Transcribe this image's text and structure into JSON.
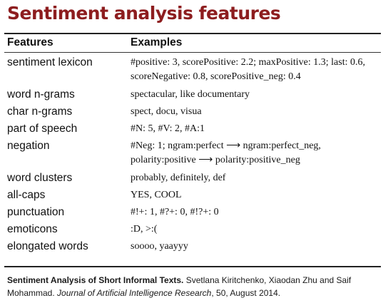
{
  "title": "Sentiment analysis features",
  "table": {
    "headers": {
      "features": "Features",
      "examples": "Examples"
    },
    "rows": [
      {
        "feature": "sentiment lexicon",
        "example": "#positive: 3, scorePositive: 2.2; maxPositive: 1.3; last: 0.6, scoreNegative: 0.8, scorePositive_neg: 0.4"
      },
      {
        "feature": "word n-grams",
        "example": "spectacular, like documentary"
      },
      {
        "feature": "char n-grams",
        "example": "spect, docu, visua"
      },
      {
        "feature": "part of speech",
        "example": "#N: 5, #V: 2, #A:1"
      },
      {
        "feature": "negation",
        "example": "#Neg: 1; ngram:perfect ⟶ ngram:perfect_neg, polarity:positive ⟶ polarity:positive_neg"
      },
      {
        "feature": "word clusters",
        "example": "probably, definitely, def"
      },
      {
        "feature": "all-caps",
        "example": "YES, COOL"
      },
      {
        "feature": "punctuation",
        "example": "#!+: 1, #?+: 0, #!?+: 0"
      },
      {
        "feature": "emoticons",
        "example": ":D, >:("
      },
      {
        "feature": "elongated words",
        "example": "soooo, yaayyy"
      }
    ]
  },
  "caption": {
    "paper_title": "Sentiment Analysis of Short Informal Texts.",
    "authors": " Svetlana Kiritchenko, Xiaodan Zhu and Saif Mohammad. ",
    "journal": "Journal of Artificial Intelligence Research",
    "details": ", 50, August 2014."
  }
}
